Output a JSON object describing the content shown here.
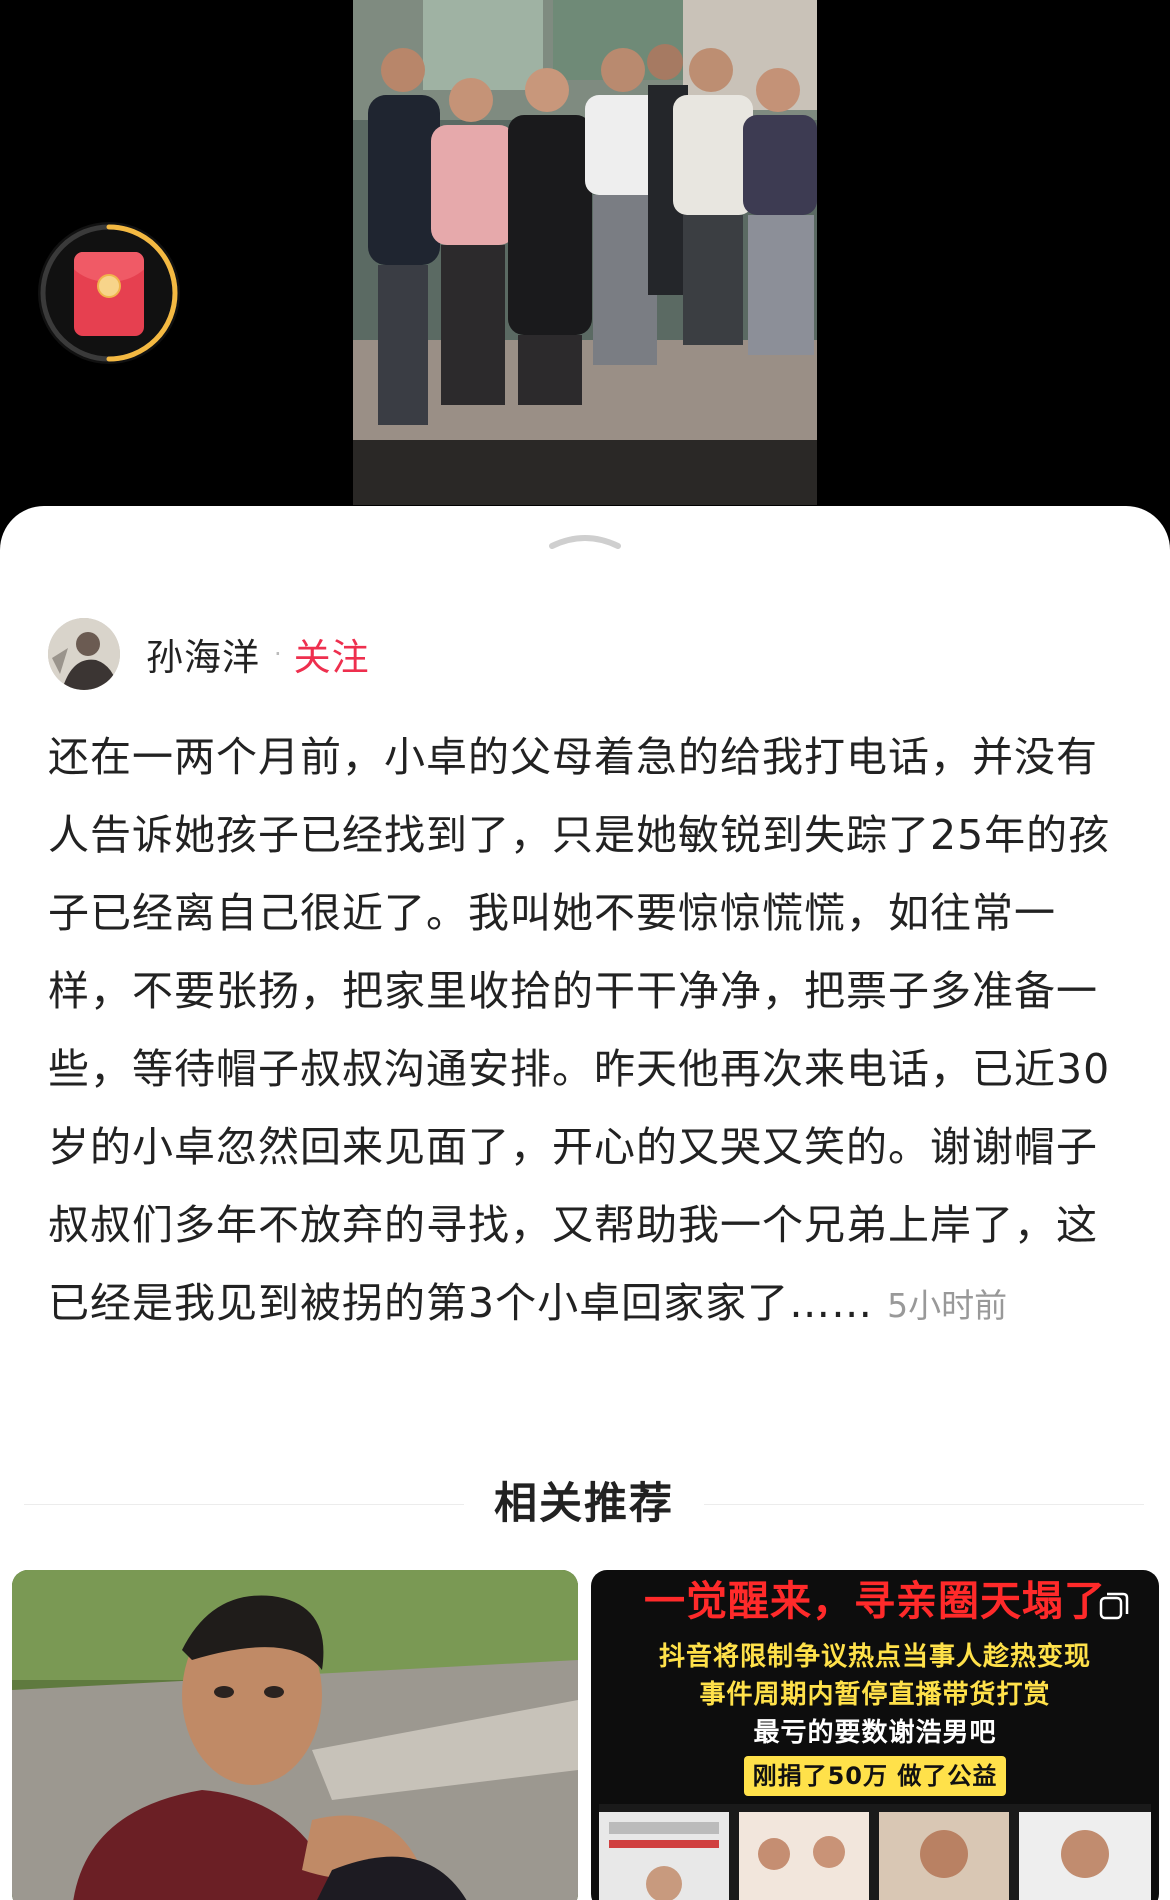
{
  "post": {
    "author_name": "孙海洋",
    "separator": "·",
    "follow_label": "关注",
    "text": "还在一两个月前，小卓的父母着急的给我打电话，并没有人告诉她孩子已经找到了，只是她敏锐到失踪了25年的孩子已经离自己很近了。我叫她不要惊惊慌慌，如往常一样，不要张扬，把家里收拾的干干净净，把票子多准备一些，等待帽子叔叔沟通安排。昨天他再次来电话，已近30岁的小卓忽然回来见面了，开心的又哭又笑的。谢谢帽子叔叔们多年不放弃的寻找，又帮助我一个兄弟上岸了，这已经是我见到被拐的第3个小卓回家家了……",
    "time": "5小时前"
  },
  "recommend": {
    "title": "相关推荐",
    "cards": [
      {
        "type": "photo"
      },
      {
        "headline": "一觉醒来，寻亲圈天塌了",
        "line1": "抖音将限制争议热点当事人趁热变现",
        "line2": "事件周期内暂停直播带货打赏",
        "line3": "最亏的要数谢浩男吧",
        "pill": "刚捐了50万 做了公益"
      }
    ]
  },
  "icons": {
    "red_packet": "red-packet-icon",
    "handle": "chevron-up-icon",
    "collect": "collection-icon"
  },
  "colors": {
    "follow": "#ee2f4e",
    "headline_red": "#ff2a2a",
    "subtitle_yellow": "#ffe14a",
    "packet_red": "#e64050",
    "ring_gold": "#f4b942"
  }
}
